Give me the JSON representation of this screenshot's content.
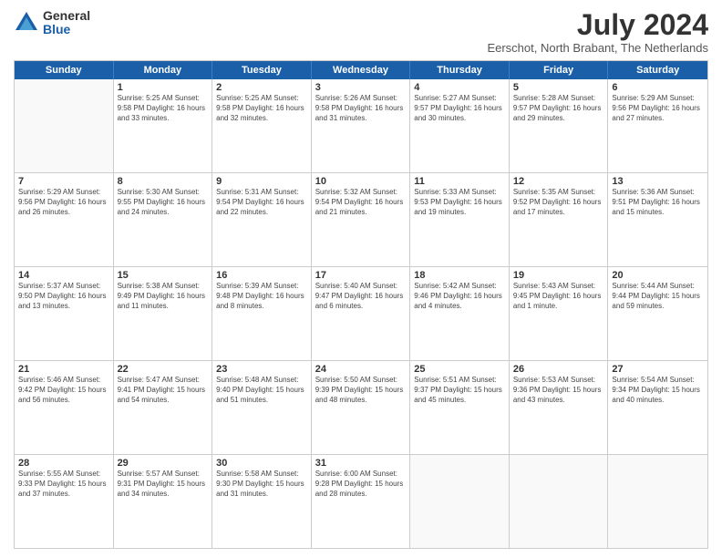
{
  "logo": {
    "general": "General",
    "blue": "Blue"
  },
  "title": "July 2024",
  "location": "Eerschot, North Brabant, The Netherlands",
  "header_days": [
    "Sunday",
    "Monday",
    "Tuesday",
    "Wednesday",
    "Thursday",
    "Friday",
    "Saturday"
  ],
  "weeks": [
    [
      {
        "day": "",
        "info": ""
      },
      {
        "day": "1",
        "info": "Sunrise: 5:25 AM\nSunset: 9:58 PM\nDaylight: 16 hours\nand 33 minutes."
      },
      {
        "day": "2",
        "info": "Sunrise: 5:25 AM\nSunset: 9:58 PM\nDaylight: 16 hours\nand 32 minutes."
      },
      {
        "day": "3",
        "info": "Sunrise: 5:26 AM\nSunset: 9:58 PM\nDaylight: 16 hours\nand 31 minutes."
      },
      {
        "day": "4",
        "info": "Sunrise: 5:27 AM\nSunset: 9:57 PM\nDaylight: 16 hours\nand 30 minutes."
      },
      {
        "day": "5",
        "info": "Sunrise: 5:28 AM\nSunset: 9:57 PM\nDaylight: 16 hours\nand 29 minutes."
      },
      {
        "day": "6",
        "info": "Sunrise: 5:29 AM\nSunset: 9:56 PM\nDaylight: 16 hours\nand 27 minutes."
      }
    ],
    [
      {
        "day": "7",
        "info": "Sunrise: 5:29 AM\nSunset: 9:56 PM\nDaylight: 16 hours\nand 26 minutes."
      },
      {
        "day": "8",
        "info": "Sunrise: 5:30 AM\nSunset: 9:55 PM\nDaylight: 16 hours\nand 24 minutes."
      },
      {
        "day": "9",
        "info": "Sunrise: 5:31 AM\nSunset: 9:54 PM\nDaylight: 16 hours\nand 22 minutes."
      },
      {
        "day": "10",
        "info": "Sunrise: 5:32 AM\nSunset: 9:54 PM\nDaylight: 16 hours\nand 21 minutes."
      },
      {
        "day": "11",
        "info": "Sunrise: 5:33 AM\nSunset: 9:53 PM\nDaylight: 16 hours\nand 19 minutes."
      },
      {
        "day": "12",
        "info": "Sunrise: 5:35 AM\nSunset: 9:52 PM\nDaylight: 16 hours\nand 17 minutes."
      },
      {
        "day": "13",
        "info": "Sunrise: 5:36 AM\nSunset: 9:51 PM\nDaylight: 16 hours\nand 15 minutes."
      }
    ],
    [
      {
        "day": "14",
        "info": "Sunrise: 5:37 AM\nSunset: 9:50 PM\nDaylight: 16 hours\nand 13 minutes."
      },
      {
        "day": "15",
        "info": "Sunrise: 5:38 AM\nSunset: 9:49 PM\nDaylight: 16 hours\nand 11 minutes."
      },
      {
        "day": "16",
        "info": "Sunrise: 5:39 AM\nSunset: 9:48 PM\nDaylight: 16 hours\nand 8 minutes."
      },
      {
        "day": "17",
        "info": "Sunrise: 5:40 AM\nSunset: 9:47 PM\nDaylight: 16 hours\nand 6 minutes."
      },
      {
        "day": "18",
        "info": "Sunrise: 5:42 AM\nSunset: 9:46 PM\nDaylight: 16 hours\nand 4 minutes."
      },
      {
        "day": "19",
        "info": "Sunrise: 5:43 AM\nSunset: 9:45 PM\nDaylight: 16 hours\nand 1 minute."
      },
      {
        "day": "20",
        "info": "Sunrise: 5:44 AM\nSunset: 9:44 PM\nDaylight: 15 hours\nand 59 minutes."
      }
    ],
    [
      {
        "day": "21",
        "info": "Sunrise: 5:46 AM\nSunset: 9:42 PM\nDaylight: 15 hours\nand 56 minutes."
      },
      {
        "day": "22",
        "info": "Sunrise: 5:47 AM\nSunset: 9:41 PM\nDaylight: 15 hours\nand 54 minutes."
      },
      {
        "day": "23",
        "info": "Sunrise: 5:48 AM\nSunset: 9:40 PM\nDaylight: 15 hours\nand 51 minutes."
      },
      {
        "day": "24",
        "info": "Sunrise: 5:50 AM\nSunset: 9:39 PM\nDaylight: 15 hours\nand 48 minutes."
      },
      {
        "day": "25",
        "info": "Sunrise: 5:51 AM\nSunset: 9:37 PM\nDaylight: 15 hours\nand 45 minutes."
      },
      {
        "day": "26",
        "info": "Sunrise: 5:53 AM\nSunset: 9:36 PM\nDaylight: 15 hours\nand 43 minutes."
      },
      {
        "day": "27",
        "info": "Sunrise: 5:54 AM\nSunset: 9:34 PM\nDaylight: 15 hours\nand 40 minutes."
      }
    ],
    [
      {
        "day": "28",
        "info": "Sunrise: 5:55 AM\nSunset: 9:33 PM\nDaylight: 15 hours\nand 37 minutes."
      },
      {
        "day": "29",
        "info": "Sunrise: 5:57 AM\nSunset: 9:31 PM\nDaylight: 15 hours\nand 34 minutes."
      },
      {
        "day": "30",
        "info": "Sunrise: 5:58 AM\nSunset: 9:30 PM\nDaylight: 15 hours\nand 31 minutes."
      },
      {
        "day": "31",
        "info": "Sunrise: 6:00 AM\nSunset: 9:28 PM\nDaylight: 15 hours\nand 28 minutes."
      },
      {
        "day": "",
        "info": ""
      },
      {
        "day": "",
        "info": ""
      },
      {
        "day": "",
        "info": ""
      }
    ]
  ]
}
